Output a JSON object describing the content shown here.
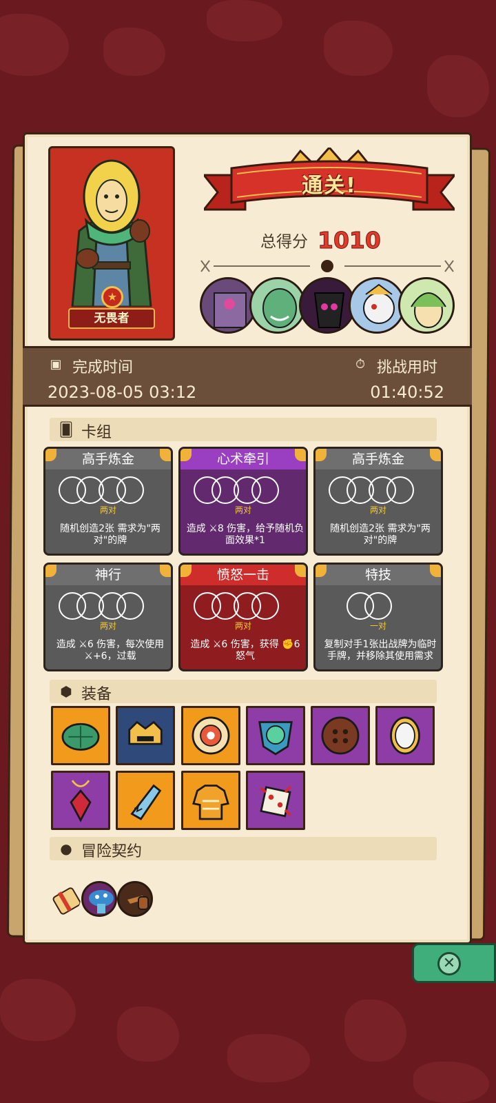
{
  "hero": {
    "name": "无畏者"
  },
  "result": {
    "banner_text": "通关!",
    "score_label": "总得分",
    "score_value": "1010"
  },
  "stats": {
    "finish_time_label": "完成时间",
    "finish_time_value": "2023-08-05 03:12",
    "challenge_time_label": "挑战用时",
    "challenge_time_value": "01:40:52"
  },
  "bosses": [
    "boss-1",
    "boss-2",
    "boss-3",
    "boss-4",
    "boss-5"
  ],
  "deck": {
    "title": "卡组",
    "cards": [
      {
        "name": "高手炼金",
        "rank": "两对",
        "desc": "随机创造2张 需求为\"两对\"的牌",
        "color": "gray",
        "circles": 2
      },
      {
        "name": "心术牵引",
        "rank": "两对",
        "desc": "造成 ⚔8 伤害，给予随机负面效果*1",
        "color": "purple",
        "circles": 2
      },
      {
        "name": "高手炼金",
        "rank": "两对",
        "desc": "随机创造2张 需求为\"两对\"的牌",
        "color": "gray",
        "circles": 2
      },
      {
        "name": "神行",
        "rank": "两对",
        "desc": "造成 ⚔6 伤害，每次使用⚔+6，过载",
        "color": "gray",
        "circles": 2
      },
      {
        "name": "愤怒一击",
        "rank": "两对",
        "desc": "造成 ⚔6 伤害，获得 ✊6 怒气",
        "color": "red",
        "circles": 2
      },
      {
        "name": "特技",
        "rank": "一对",
        "desc": "复制对手1张出战牌为临时手牌，并移除其使用需求",
        "color": "gray",
        "circles": 1
      }
    ]
  },
  "equipment": {
    "title": "装备",
    "items": [
      {
        "icon": "turtle-shell-icon",
        "color": "orange"
      },
      {
        "icon": "golden-helmet-icon",
        "color": "navy"
      },
      {
        "icon": "round-shield-icon",
        "color": "orange"
      },
      {
        "icon": "demon-badge-icon",
        "color": "violet"
      },
      {
        "icon": "button-icon",
        "color": "violet"
      },
      {
        "icon": "mirror-icon",
        "color": "violet"
      },
      {
        "icon": "red-gem-amulet-icon",
        "color": "violet"
      },
      {
        "icon": "broken-bottle-icon",
        "color": "orange"
      },
      {
        "icon": "sweater-icon",
        "color": "orange"
      },
      {
        "icon": "spiked-dice-icon",
        "color": "violet"
      }
    ]
  },
  "contracts": {
    "title": "冒险契约",
    "items": [
      "scroll-icon",
      "mushroom-creature-icon",
      "pipe-icon"
    ]
  },
  "colors": {
    "gold": "#f3c93e",
    "score_red": "#e23a2a",
    "close_green": "#3fae7a"
  }
}
